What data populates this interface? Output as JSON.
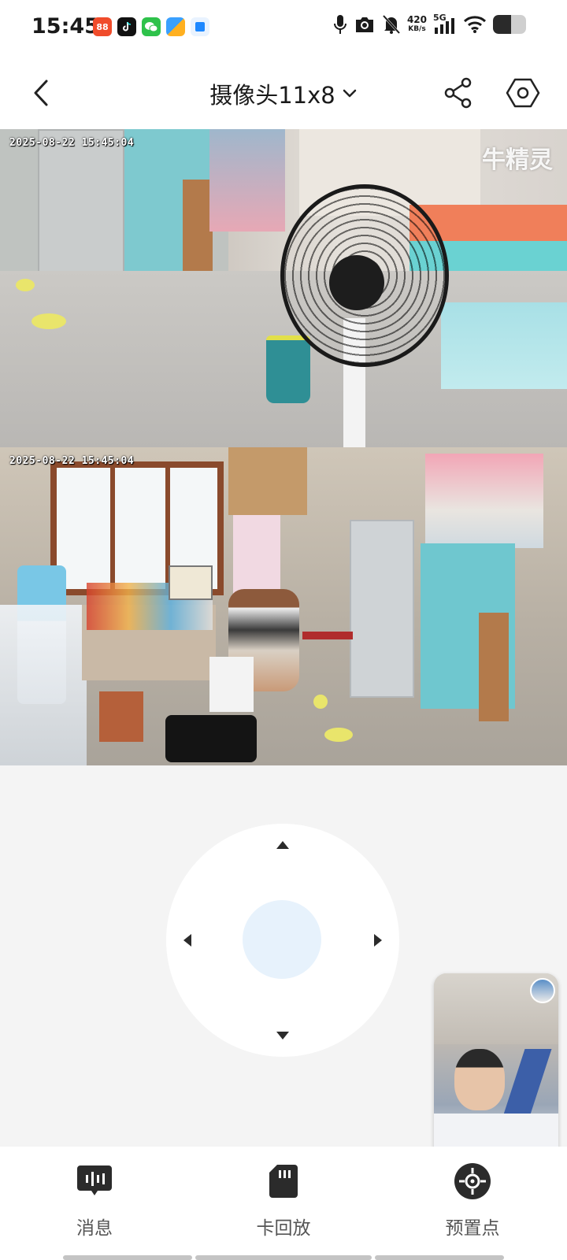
{
  "status_bar": {
    "time": "15:45",
    "net_speed_value": "420",
    "net_speed_unit": "KB/s",
    "signal_label": "5G",
    "app_icons": [
      "app-orange-icon",
      "tiktok-icon",
      "wechat-icon",
      "files-icon",
      "app-blue-icon"
    ],
    "sys_icons": [
      "microphone-icon",
      "camera-icon",
      "bell-muted-icon",
      "network-speed",
      "signal-icon",
      "wifi-icon",
      "battery-icon"
    ],
    "battery_level": 0.55
  },
  "header": {
    "title": "摄像头11x8",
    "back_icon": "chevron-left-icon",
    "title_dropdown_icon": "chevron-down-icon",
    "share_icon": "share-icon",
    "settings_icon": "hexagon-settings-icon"
  },
  "feeds": [
    {
      "timestamp": "2025-08-22 15:45:04",
      "watermark": "牛精灵"
    },
    {
      "timestamp": "2025-08-22 15:45:04"
    }
  ],
  "ptz": {
    "up_icon": "caret-up-icon",
    "down_icon": "caret-down-icon",
    "left_icon": "caret-left-icon",
    "right_icon": "caret-right-icon"
  },
  "bottom_nav": {
    "items": [
      {
        "label": "消息",
        "icon": "message-icon"
      },
      {
        "label": "卡回放",
        "icon": "sd-card-icon"
      },
      {
        "label": "预置点",
        "icon": "preset-point-icon"
      }
    ]
  },
  "colors": {
    "background": "#f4f4f4",
    "pad": "#ffffff",
    "pad_center": "#e7f2fc",
    "icon_dark": "#2b2b2b",
    "label": "#555555"
  }
}
